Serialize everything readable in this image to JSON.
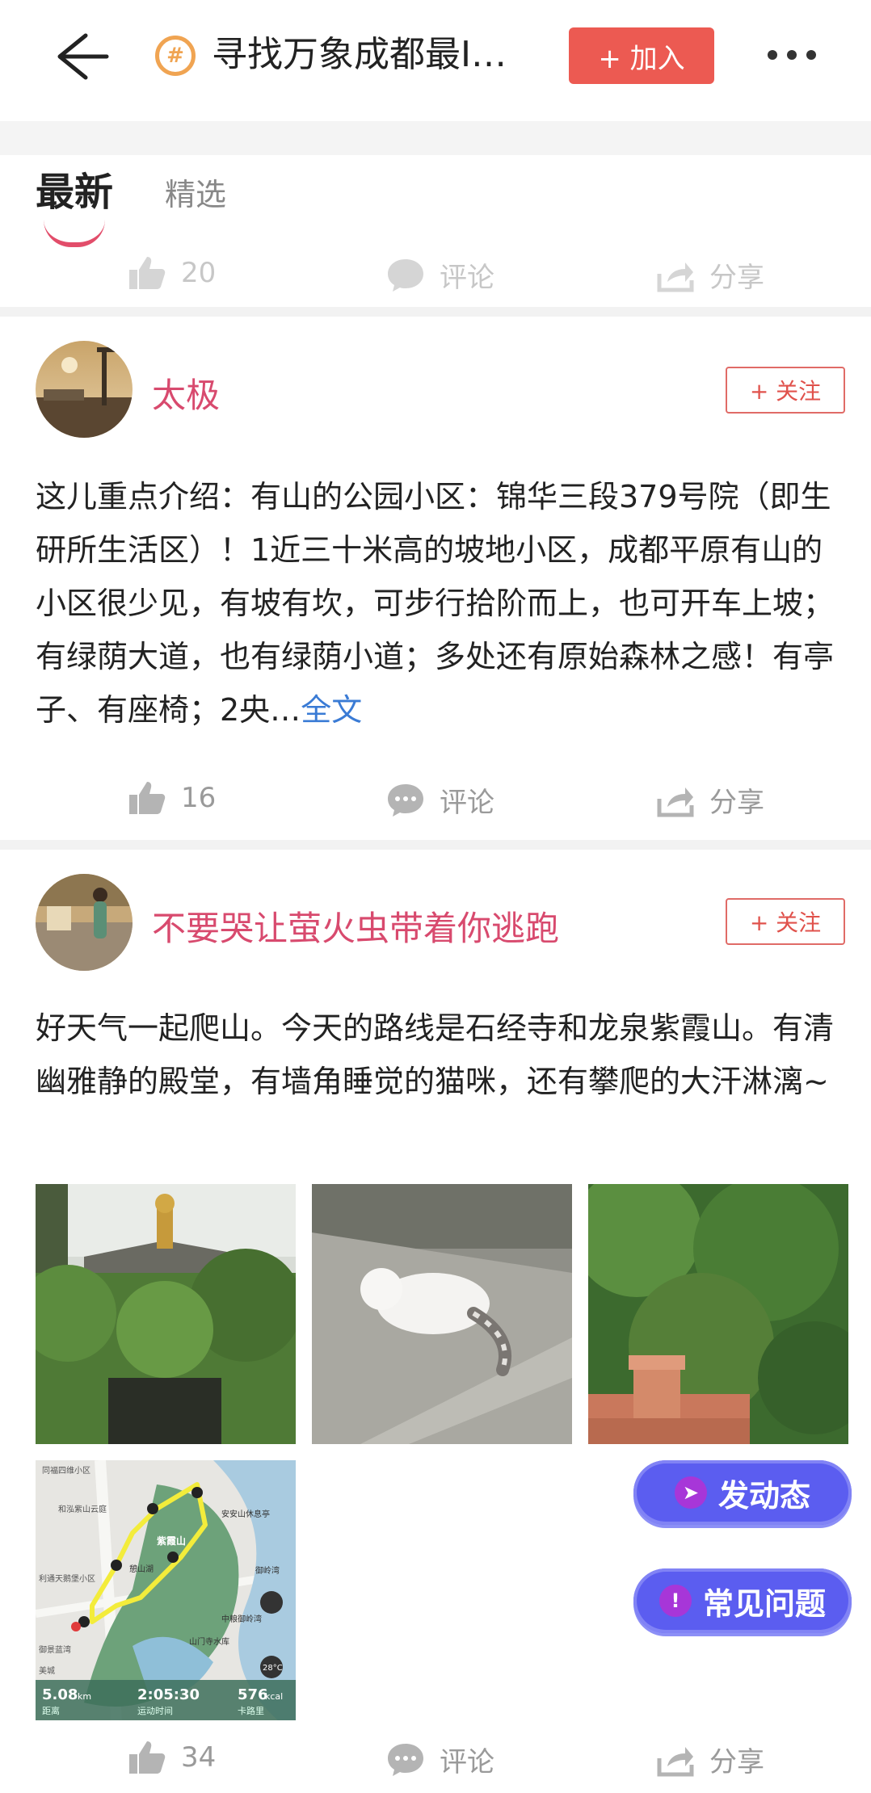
{
  "header": {
    "topic_title": "寻找万象成都最I…",
    "topic_icon": "#",
    "join_label": "+ 加入"
  },
  "tabs": [
    {
      "label": "最新",
      "active": true
    },
    {
      "label": "精选",
      "active": false
    }
  ],
  "prev_post_actions": {
    "like_count": "20",
    "comment_label": "评论",
    "share_label": "分享"
  },
  "posts": [
    {
      "username": "太极",
      "follow_label": "+ 关注",
      "text": "这儿重点介绍：有山的公园小区：锦华三段379号院（即生研所生活区）！1近三十米高的坡地小区，成都平原有山的小区很少见，有坡有坎，可步行拾阶而上，也可开车上坡；有绿荫大道，也有绿荫小道；多处还有原始森林之感！有亭子、有座椅；2央…",
      "more_label": "全文",
      "like_count": "16",
      "comment_label": "评论",
      "share_label": "分享"
    },
    {
      "username": "不要哭让萤火虫带着你逃跑",
      "follow_label": "+ 关注",
      "text": "好天气一起爬山。今天的路线是石经寺和龙泉紫霞山。有清幽雅静的殿堂，有墙角睡觉的猫咪，还有攀爬的大汗淋漓~",
      "like_count": "34",
      "comment_label": "评论",
      "share_label": "分享",
      "map": {
        "distance": "5.08",
        "distance_unit": "km",
        "distance_label": "距离",
        "duration": "2:05:30",
        "duration_label": "运动时间",
        "calories": "576",
        "calories_unit": "kcal",
        "calories_label": "卡路里",
        "temperature": "28°C",
        "place_labels": [
          "同福四维小区",
          "和泓紫山云庭",
          "利通天鹅堡小区",
          "紫霞山",
          "安安山休息亭",
          "御岭湾",
          "中粮御岭湾",
          "山门寺水库",
          "憩山湖",
          "御景蓝湾",
          "美城"
        ]
      }
    }
  ],
  "floating": {
    "post_label": "发动态",
    "faq_label": "常见问题"
  },
  "colors": {
    "accent": "#ec5a52",
    "username": "#d84a6e",
    "link": "#3a7bd5",
    "float_btn": "#5b5df0"
  }
}
